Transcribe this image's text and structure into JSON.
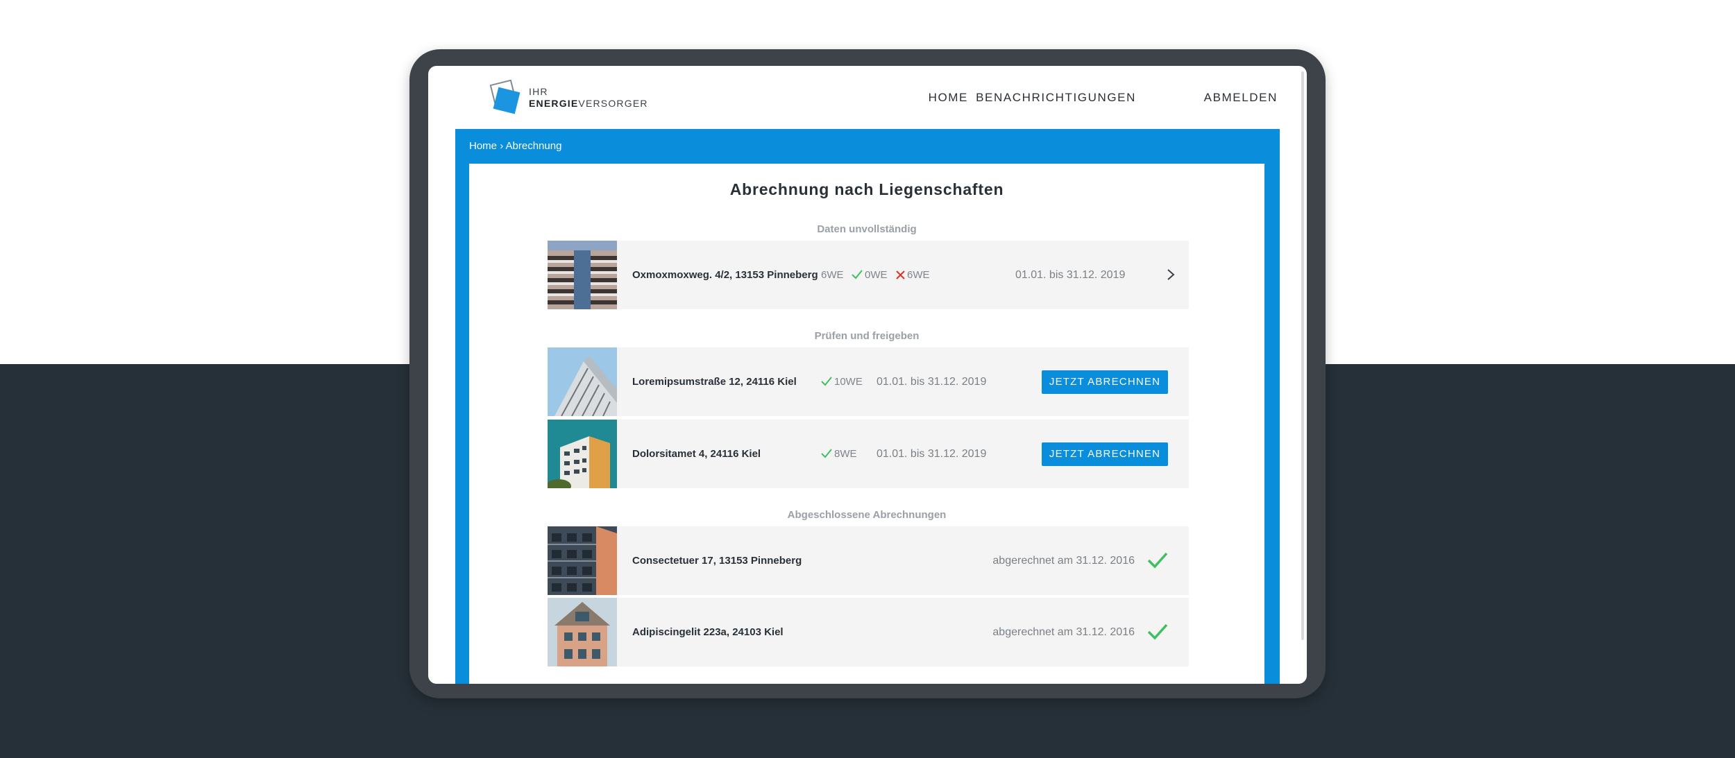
{
  "header": {
    "logo": {
      "line1": "IHR",
      "line2_bold": "ENERGIE",
      "line2_rest": "VERSORGER"
    },
    "nav": [
      {
        "label": "HOME"
      },
      {
        "label": "BENACHRICHTIGUNGEN"
      },
      {
        "label": "ABMELDEN"
      }
    ]
  },
  "breadcrumb": {
    "home": "Home",
    "separator": "›",
    "current": "Abrechnung"
  },
  "page_title": "Abrechnung nach Liegenschaften",
  "sections": {
    "incomplete": {
      "title": "Daten unvollständig",
      "rows": [
        {
          "address": "Oxmoxmoxweg. 4/2, 13153 Pinneberg",
          "total": "6WE",
          "ok": "0WE",
          "missing": "6WE",
          "period": "01.01. bis 31.12. 2019"
        }
      ]
    },
    "review": {
      "title": "Prüfen und freigeben",
      "rows": [
        {
          "address": "Loremipsumstraße 12, 24116 Kiel",
          "ok": "10WE",
          "period": "01.01. bis 31.12. 2019",
          "button": "JETZT ABRECHNEN"
        },
        {
          "address": "Dolorsitamet 4, 24116 Kiel",
          "ok": "8WE",
          "period": "01.01. bis 31.12. 2019",
          "button": "JETZT ABRECHNEN"
        }
      ]
    },
    "completed": {
      "title": "Abgeschlossene Abrechnungen",
      "rows": [
        {
          "address": "Consectetuer 17, 13153 Pinneberg",
          "status": "abgerechnet am 31.12. 2016"
        },
        {
          "address": "Adipiscingelit 223a, 24103 Kiel",
          "status": "abgerechnet am 31.12. 2016"
        }
      ]
    }
  },
  "colors": {
    "accent": "#0a8ddb",
    "success": "#3fbf5f",
    "error": "#d9342b",
    "dark_bg": "#263038"
  }
}
